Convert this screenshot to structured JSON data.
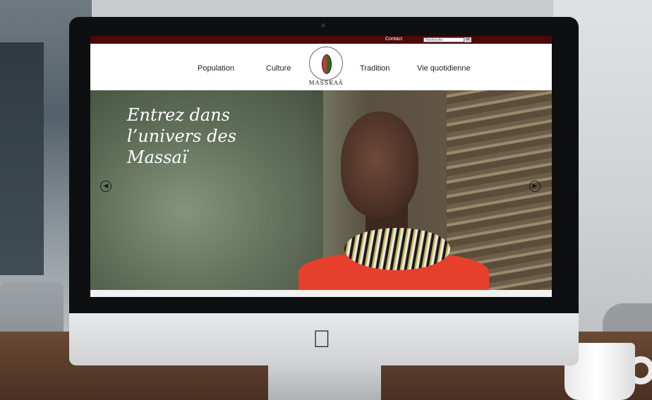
{
  "topbar": {
    "contact_label": "Contact",
    "search_placeholder": "Recherche",
    "search_button": "ok"
  },
  "nav": {
    "items": [
      {
        "label": "Population"
      },
      {
        "label": "Culture"
      },
      {
        "label": "Tradition"
      },
      {
        "label": "Vie quotidienne"
      }
    ],
    "logo_text": "MASSKAÂ"
  },
  "hero": {
    "title_line1": "Entrez dans",
    "title_line2": "l’univers des",
    "title_line3": "Massaï",
    "prev_icon": "chevron-left-icon",
    "next_icon": "chevron-right-icon"
  },
  "colors": {
    "topbar": "#4a0a0a",
    "dress": "#e6402d"
  }
}
